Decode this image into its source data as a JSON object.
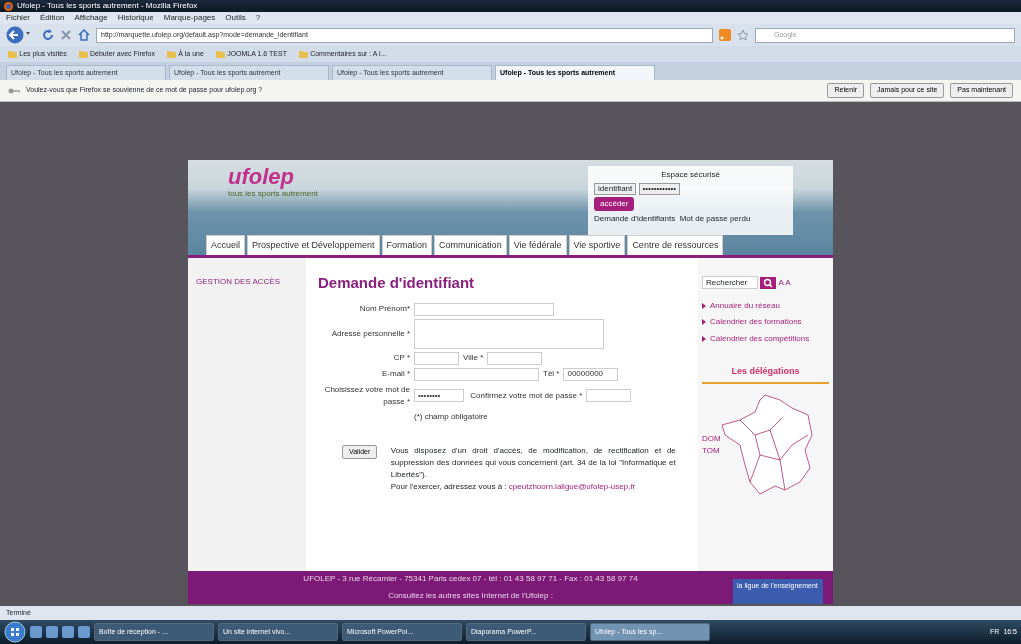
{
  "window": {
    "title": "Ufolep - Tous les sports autrement - Mozilla Firefox"
  },
  "menu": [
    "Fichier",
    "Édition",
    "Affichage",
    "Historique",
    "Marque-pages",
    "Outils",
    "?"
  ],
  "toolbar": {
    "url": "http://marquette.ufolep.org/default.asp?mode=demande_identifiant",
    "search_placeholder": "Google"
  },
  "bookmarks": [
    "Les plus visités",
    "Débuter avec Firefox",
    "À la une",
    "JOOMLA 1.6 TEST",
    "Commentaires sur : A l..."
  ],
  "tabs": [
    {
      "label": "Ufolep - Tous les sports autrement",
      "selected": false
    },
    {
      "label": "Ufolep - Tous les sports autrement",
      "selected": false
    },
    {
      "label": "Ufolep - Tous les sports autrement",
      "selected": false
    },
    {
      "label": "Ufolep - Tous les sports autrement",
      "selected": true
    }
  ],
  "password_prompt": {
    "message": "Voulez-vous que Firefox se souvienne de ce mot de passe pour ufolep.org ?",
    "buttons": [
      "Retenir",
      "Jamais pour ce site",
      "Pas maintenant"
    ]
  },
  "site": {
    "logo": "ufolep",
    "tagline": "tous les sports autrement",
    "login": {
      "title": "Espace sécurisé",
      "username_placeholder": "identifiant",
      "password_value": "••••••••••••",
      "button": "accéder",
      "links": [
        "Demande d'identifiants",
        "Mot de passe perdu"
      ]
    },
    "nav": [
      "Accueil",
      "Prospective et Développement",
      "Formation",
      "Communication",
      "Vie fédérale",
      "Vie sportive",
      "Centre de ressources"
    ],
    "sidebar_title": "GESTION DES ACCÈS",
    "form": {
      "title": "Demande d'identifiant",
      "rows": [
        {
          "kind": "single",
          "label": "Nom Prénom*"
        },
        {
          "kind": "textarea",
          "label": "Adresse personnelle *"
        },
        {
          "kind": "pair",
          "label": "CP *",
          "label2": "Ville *"
        },
        {
          "kind": "pair_wide",
          "label": "E-mail *",
          "label2": "Tél *",
          "value2": "00000000"
        },
        {
          "kind": "password",
          "label": "Choisissez votre mot de passe *",
          "value": "••••••••",
          "label2": "Confirmez votre mot de passe *"
        }
      ],
      "required_note": "(*) champ obligatoire",
      "submit": "Valider",
      "notice": "Vous disposez d'un droit d'accès, de modification, de rectification et de suppression des données qui vous concernent (art. 34 de la loi \"Informatique et Libertés\").",
      "contact_text": "Pour l'exercer, adressez vous à :",
      "contact_link": "cpeutzhoorn.laligue@ufolep-usep.fr"
    },
    "right": {
      "search_placeholder": "Rechercher",
      "text_size": "A A",
      "links": [
        "Annuaire du réseau",
        "Calendrier des formations",
        "Calendrier des compétitions"
      ],
      "delegations_title": "Les délégations",
      "map_label": "DOM TOM"
    },
    "footer": {
      "address": "UFOLEP - 3 rue Récamier - 75341 Paris cedex 07 - tél : 01 43 58 97 71 - Fax : 01 43 58 97 74",
      "sites_text": "Consultez les autres sites Internet de l'Ufolep :",
      "partner": "la ligue de l'enseignement"
    }
  },
  "status_bar": "Terminé",
  "taskbar": {
    "tasks": [
      {
        "label": "Boîte de réception - ...",
        "selected": false
      },
      {
        "label": "Un site internet vivo...",
        "selected": false
      },
      {
        "label": "Microsoft PowerPoi...",
        "selected": false
      },
      {
        "label": "Diaporama PowerP...",
        "selected": false
      },
      {
        "label": "Ufolep - Tous les sp...",
        "selected": true
      }
    ],
    "language": "FR",
    "clock": "16:5"
  }
}
